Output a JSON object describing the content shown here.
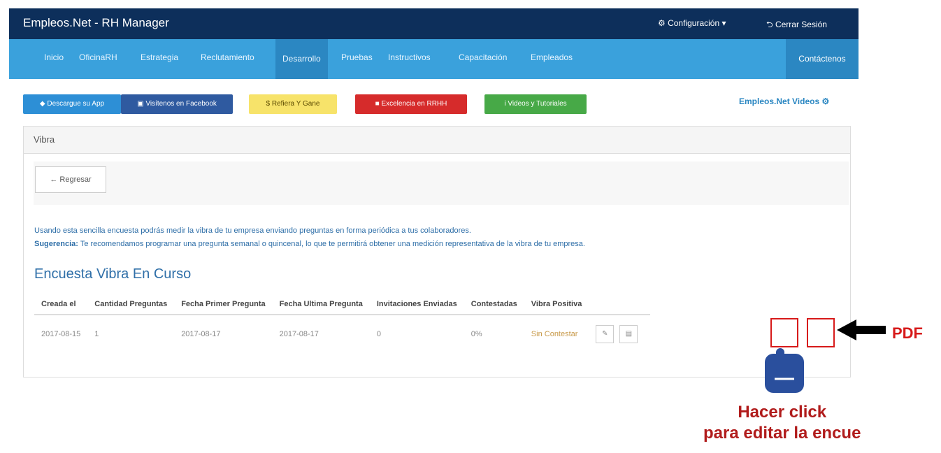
{
  "app": {
    "title": "Empleos.Net - RH Manager",
    "configuracion": "Configuración",
    "cerrar": "Cerrar Sesión"
  },
  "nav": [
    "Inicio",
    "OficinaRH",
    "Estrategia",
    "Reclutamiento",
    "Desarrollo",
    "Pruebas",
    "Instructivos",
    "Capacitación",
    "Empleados"
  ],
  "nav_active": "Desarrollo",
  "contact": "Contáctenos",
  "buttons": {
    "app": "Descargue su App",
    "facebook": "Visítenos en Facebook",
    "refer": "Refiera Y Gane",
    "excelencia": "Excelencia en RRHH",
    "videos": "Videos y Tutoriales"
  },
  "videos_link": "Empleos.Net Videos",
  "panel": {
    "title": "Vibra",
    "back": "Regresar"
  },
  "info": {
    "line1": "Usando esta sencilla encuesta podrás medir la vibra de tu empresa enviando preguntas en forma periódica a tus colaboradores.",
    "sugerencia_label": "Sugerencia:",
    "sugerencia": "Te recomendamos programar una pregunta semanal o quincenal, lo que te permitirá obtener una medición representativa de la vibra de tu empresa."
  },
  "section_title": "Encuesta Vibra En Curso",
  "table": {
    "headers": [
      "Creada el",
      "Cantidad Preguntas",
      "Fecha Primer Pregunta",
      "Fecha Ultima Pregunta",
      "Invitaciones Enviadas",
      "Contestadas",
      "Vibra Positiva"
    ],
    "rows": [
      [
        "2017-08-15",
        "1",
        "2017-08-17",
        "2017-08-17",
        "0",
        "0%",
        "Sin Contestar"
      ]
    ]
  },
  "annotation": {
    "pdf": "PDF",
    "hacer": "Hacer click",
    "para": "para editar la encue"
  }
}
